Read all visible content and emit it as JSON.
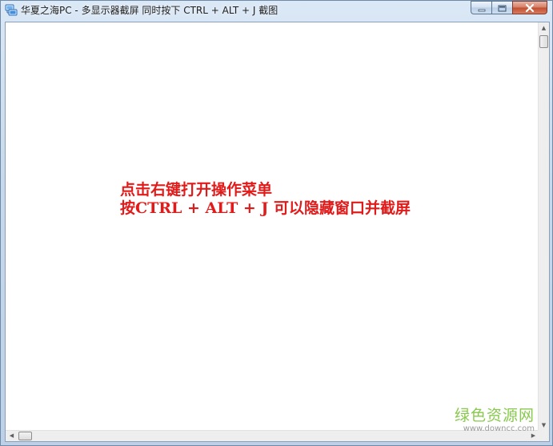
{
  "window": {
    "title": "华夏之海PC - 多显示器截屏  同时按下 CTRL + ALT + J 截图",
    "buttons": {
      "minimize": "minimize",
      "maximize": "maximize",
      "close": "close"
    }
  },
  "content": {
    "line1": "点击右键打开操作菜单",
    "line2": "按CTRL  +  ALT  +  J  可以隐藏窗口并截屏",
    "text_color": "#e11a1a"
  },
  "watermark": {
    "main": "绿色资源网",
    "sub": "www.downcc.com",
    "color": "#7cc43a"
  },
  "icons": {
    "app": "monitor-network-icon",
    "scroll_up": "scroll-up-arrow-icon",
    "scroll_down": "scroll-down-arrow-icon",
    "scroll_left": "scroll-left-arrow-icon",
    "scroll_right": "scroll-right-arrow-icon"
  }
}
